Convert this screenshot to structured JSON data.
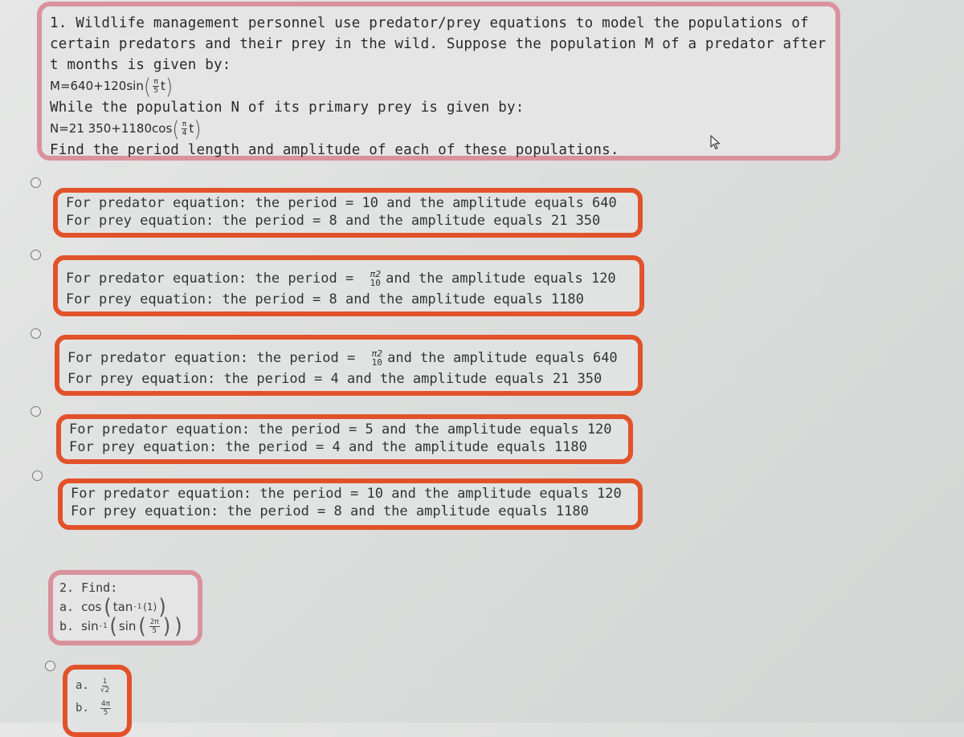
{
  "question1": {
    "lines": [
      "1. Wildlife management personnel use predator/prey equations to model the populations of",
      "certain predators and their prey in the wild. Suppose the population M of a predator after",
      "t months is given by:"
    ],
    "eq_m": {
      "lhs": "M=640+120sin",
      "frac_num": "π",
      "frac_den": "5",
      "var": "t"
    },
    "prey_line": "While the population N of its primary prey is given by:",
    "eq_n": {
      "lhs": "N=21 350+1180cos",
      "frac_num": "π",
      "frac_den": "4",
      "var": "t"
    },
    "instruction": "Find the period length and amplitude of each of these populations."
  },
  "answers": [
    {
      "predator_prefix": "For predator equation: the period = ",
      "predator_period": "10",
      "predator_suffix": " and the amplitude equals 640",
      "prey_prefix": "For prey equation: the period = ",
      "prey_period": "8",
      "prey_suffix": " and the amplitude equals 21 350",
      "selected": false
    },
    {
      "predator_prefix": "For predator equation: the period = ",
      "predator_period_num": "π2",
      "predator_period_den": "10",
      "predator_suffix": "and the amplitude equals 120",
      "prey_prefix": "For prey equation: the period = ",
      "prey_period": "8",
      "prey_suffix": " and the amplitude equals 1180",
      "selected": false
    },
    {
      "predator_prefix": "For predator equation: the period = ",
      "predator_period_num": "π2",
      "predator_period_den": "10",
      "predator_suffix": "and the amplitude equals 640",
      "prey_prefix": "For prey equation: the period = ",
      "prey_period": "4",
      "prey_suffix": " and the amplitude equals 21 350",
      "selected": false
    },
    {
      "predator_prefix": "For predator equation: the period = ",
      "predator_period": "5",
      "predator_suffix": " and the amplitude equals 120",
      "prey_prefix": "For prey equation: the period = ",
      "prey_period": "4",
      "prey_suffix": " and the amplitude equals 1180",
      "selected": false
    },
    {
      "predator_prefix": "For predator equation: the period = ",
      "predator_period": "10",
      "predator_suffix": " and the amplitude equals 120",
      "prey_prefix": "For prey equation: the period = ",
      "prey_period": "8",
      "prey_suffix": " and the amplitude equals 1180",
      "selected": false
    }
  ],
  "question2": {
    "title": "2. Find:",
    "a_label": "a.",
    "a_fn_outer": "cos",
    "a_fn_inner": "tan",
    "a_inv": "-1",
    "a_arg": "(1)",
    "b_label": "b.",
    "b_fn_outer": "sin",
    "b_inv": "-1",
    "b_fn_inner": "sin",
    "b_frac_num": "2π",
    "b_frac_den": "5"
  },
  "answer_q2": {
    "a_label": "a.",
    "a_num": "1",
    "a_den": "√2",
    "b_label": "b.",
    "b_num": "4π",
    "b_den": "5",
    "selected": false
  },
  "colors": {
    "question_border": "#d9929c",
    "answer_border": "#e2522a",
    "background": "#dfe0df"
  }
}
